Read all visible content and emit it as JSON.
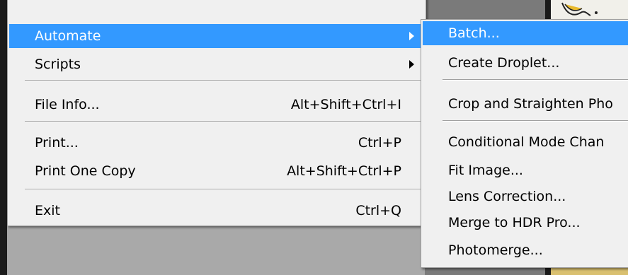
{
  "main_menu": {
    "items": [
      {
        "label": "Automate",
        "shortcut": ""
      },
      {
        "label": "Scripts",
        "shortcut": ""
      },
      {
        "label": "File Info...",
        "shortcut": "Alt+Shift+Ctrl+I"
      },
      {
        "label": "Print...",
        "shortcut": "Ctrl+P"
      },
      {
        "label": "Print One Copy",
        "shortcut": "Alt+Shift+Ctrl+P"
      },
      {
        "label": "Exit",
        "shortcut": "Ctrl+Q"
      }
    ]
  },
  "automate_submenu": {
    "items": [
      {
        "label": "Batch..."
      },
      {
        "label": "Create Droplet..."
      },
      {
        "label": "Crop and Straighten Pho"
      },
      {
        "label": "Conditional Mode Chan"
      },
      {
        "label": "Fit Image..."
      },
      {
        "label": "Lens Correction..."
      },
      {
        "label": "Merge to HDR Pro..."
      },
      {
        "label": "Photomerge..."
      }
    ]
  },
  "colors": {
    "highlight": "#3399ff",
    "menu_bg": "#f0f0f0",
    "background": "#1b1b1b"
  }
}
